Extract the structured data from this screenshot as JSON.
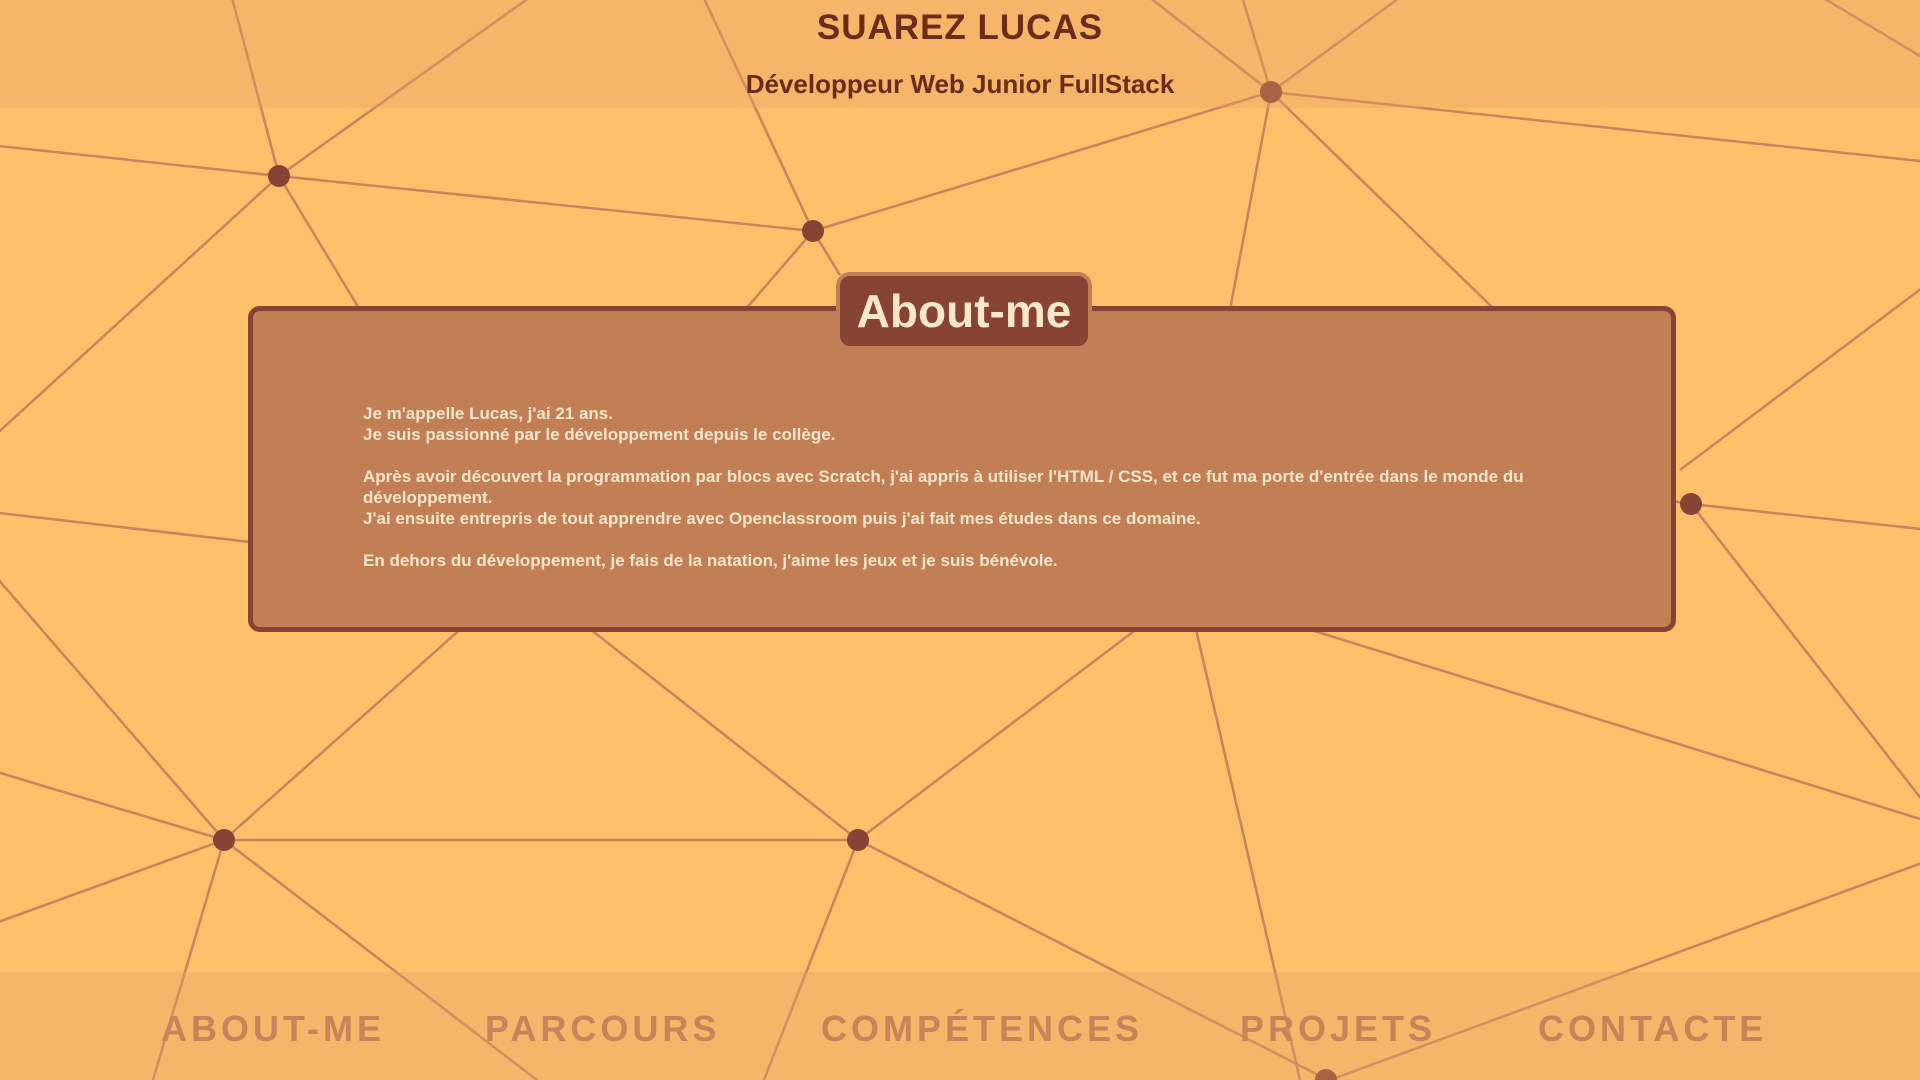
{
  "header": {
    "name": "SUAREZ LUCAS",
    "subtitle": "Développeur Web Junior FullStack"
  },
  "about": {
    "title": "About-me",
    "paragraphs": [
      [
        "Je m'appelle Lucas, j'ai 21 ans.",
        "Je suis passionné par le développement depuis le collège."
      ],
      [
        "Après avoir découvert la programmation par blocs avec Scratch, j'ai appris à utiliser l'HTML / CSS, et ce fut ma porte d'entrée dans le monde du développement.",
        "J'ai ensuite entrepris de tout apprendre avec Openclassroom puis j'ai fait mes études dans ce domaine."
      ],
      [
        "En dehors du développement, je fais de la natation, j'aime les jeux et je suis bénévole."
      ]
    ]
  },
  "nav": {
    "items": [
      {
        "label": "ABOUT-ME"
      },
      {
        "label": "PARCOURS"
      },
      {
        "label": "COMPÉTENCES"
      },
      {
        "label": "PROJETS"
      },
      {
        "label": "CONTACTE"
      }
    ]
  },
  "colors": {
    "background": "#ffc06c",
    "line": "#c8845a",
    "node": "#874334",
    "card": "#c27e54",
    "accent": "#874334",
    "text_light": "#fde6cc",
    "text_dark": "#6b2c1a"
  }
}
